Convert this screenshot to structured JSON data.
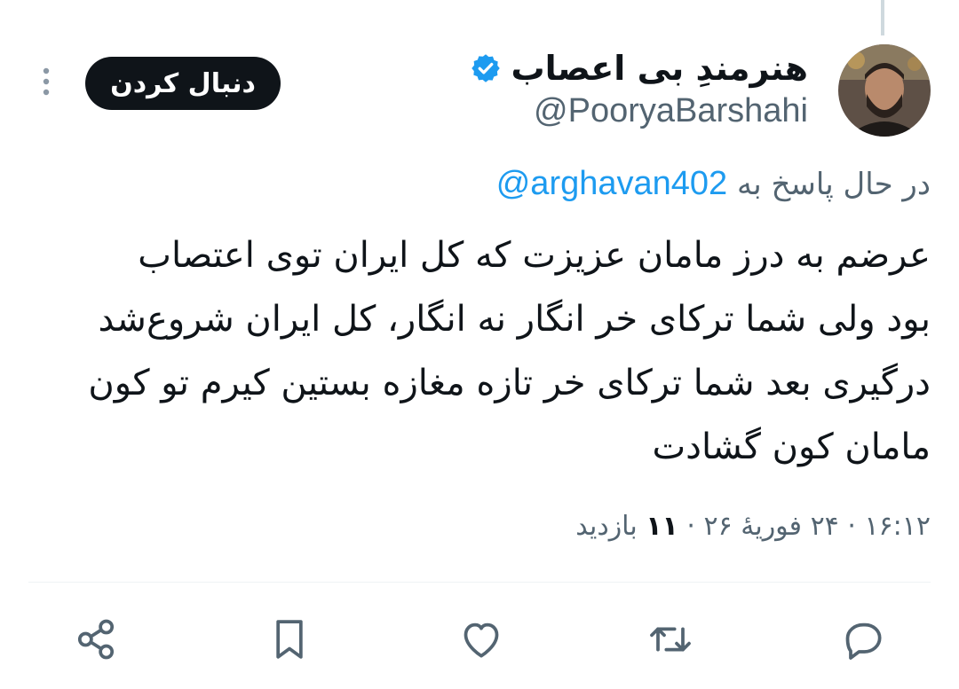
{
  "author": {
    "name": "هنرمندِ بی اعصاب",
    "handle": "@PooryaBarshahi",
    "verified": true,
    "verified_color": "#1d9bf0"
  },
  "follow_button": {
    "label": "دنبال کردن"
  },
  "reply": {
    "prefix": "در حال پاسخ به",
    "mention": "@arghavan402"
  },
  "tweet": {
    "lines": [
      "عرضم به درز مامان عزیزت که کل ایران توی اعتصاب",
      "بود ولی شما ترکای خر انگار نه انگار، کل ایران شروع‌شد",
      "درگیری بعد شما ترکای خر تازه مغازه بستین کیرم تو کون",
      "مامان کون گشادت"
    ]
  },
  "meta": {
    "time": "۱۶:۱۲",
    "date": "۲۴ فوریهٔ ۲۶",
    "separator": "·",
    "views_count": "۱۱",
    "views_label": "بازدید"
  },
  "actions": {
    "icons": [
      "reply-icon",
      "retweet-icon",
      "like-icon",
      "bookmark-icon",
      "share-icon"
    ]
  },
  "colors": {
    "text_primary": "#0f1419",
    "text_secondary": "#536471",
    "accent": "#1d9bf0",
    "divider": "#eff3f4"
  }
}
